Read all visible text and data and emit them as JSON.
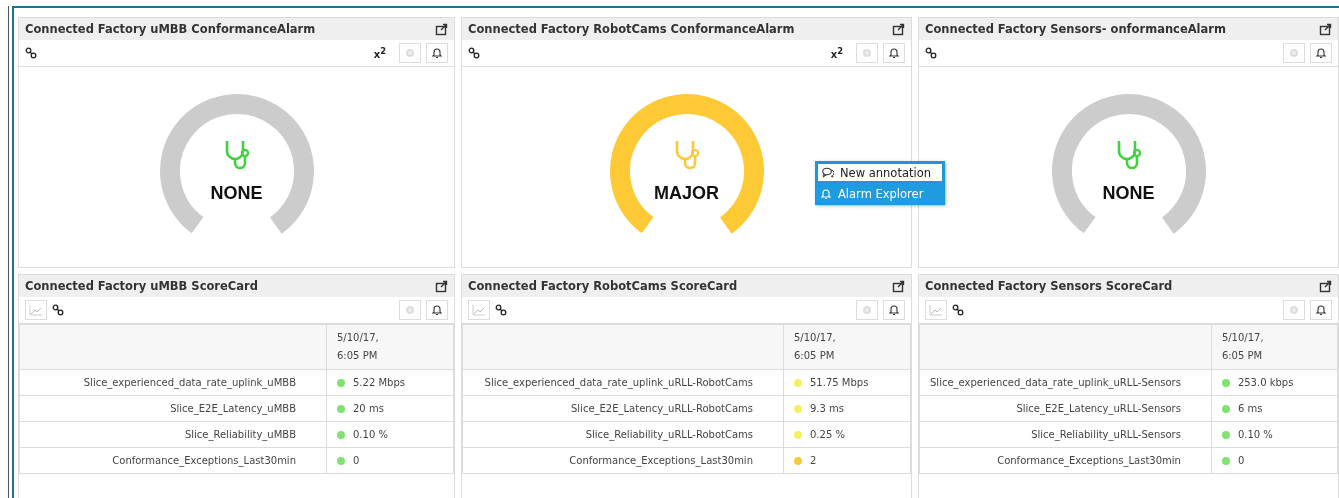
{
  "alarm_panels": [
    {
      "title": "Connected Factory uMBB ConformanceAlarm",
      "toolbar_text": "x$^{2}$",
      "gauge": {
        "label": "NONE",
        "color": "#cccccc",
        "icon": {
          "color": "#3fd23f"
        }
      }
    },
    {
      "title": "Connected Factory RobotCams ConformanceAlarm",
      "toolbar_text": "x$^{2}$",
      "gauge": {
        "label": "MAJOR",
        "color": "#fdca36",
        "icon": {
          "color": "#fdca36"
        }
      }
    },
    {
      "title": "Connected Factory Sensors- onformanceAlarm",
      "gauge": {
        "label": "NONE",
        "color": "#cccccc",
        "icon": {
          "color": "#3fd23f"
        }
      }
    }
  ],
  "scorecards": [
    {
      "title": "Connected Factory uMBB ScoreCard",
      "column_header": "5/10/17, 6:05 PM",
      "rows": [
        {
          "metric": "Slice_experienced_data_rate_uplink_uMBB",
          "value": "5.22 Mbps",
          "color": "#7fe36e"
        },
        {
          "metric": "Slice_E2E_Latency_uMBB",
          "value": "20 ms",
          "color": "#7fe36e"
        },
        {
          "metric": "Slice_Reliability_uMBB",
          "value": "0.10 %",
          "color": "#7fe36e"
        },
        {
          "metric": "Conformance_Exceptions_Last30min",
          "value": "0",
          "color": "#7fe36e"
        }
      ]
    },
    {
      "title": "Connected Factory RobotCams ScoreCard",
      "column_header": "5/10/17, 6:05 PM",
      "rows": [
        {
          "metric": "Slice_experienced_data_rate_uplink_uRLL-RobotCams",
          "value": "51.75 Mbps",
          "color": "#f5f062"
        },
        {
          "metric": "Slice_E2E_Latency_uRLL-RobotCams",
          "value": "9.3 ms",
          "color": "#f5f062"
        },
        {
          "metric": "Slice_Reliability_uRLL-RobotCams",
          "value": "0.25 %",
          "color": "#f5f062"
        },
        {
          "metric": "Conformance_Exceptions_Last30min",
          "value": "2",
          "color": "#f6c83c"
        }
      ]
    },
    {
      "title": "Connected Factory Sensors ScoreCard",
      "column_header": "5/10/17, 6:05 PM",
      "rows": [
        {
          "metric": "Slice_experienced_data_rate_uplink_uRLL-Sensors",
          "value": "253.0 kbps",
          "color": "#7fe36e"
        },
        {
          "metric": "Slice_E2E_Latency_uRLL-Sensors",
          "value": "6 ms",
          "color": "#7fe36e"
        },
        {
          "metric": "Slice_Reliability_uRLL-Sensors",
          "value": "0.10 %",
          "color": "#7fe36e"
        },
        {
          "metric": "Conformance_Exceptions_Last30min",
          "value": "0",
          "color": "#7fe36e"
        }
      ]
    }
  ],
  "context_menu": {
    "items": [
      {
        "label": "New annotation",
        "kind": "annotation",
        "selected": false
      },
      {
        "label": "Alarm Explorer",
        "kind": "alarm",
        "selected": true
      }
    ]
  }
}
